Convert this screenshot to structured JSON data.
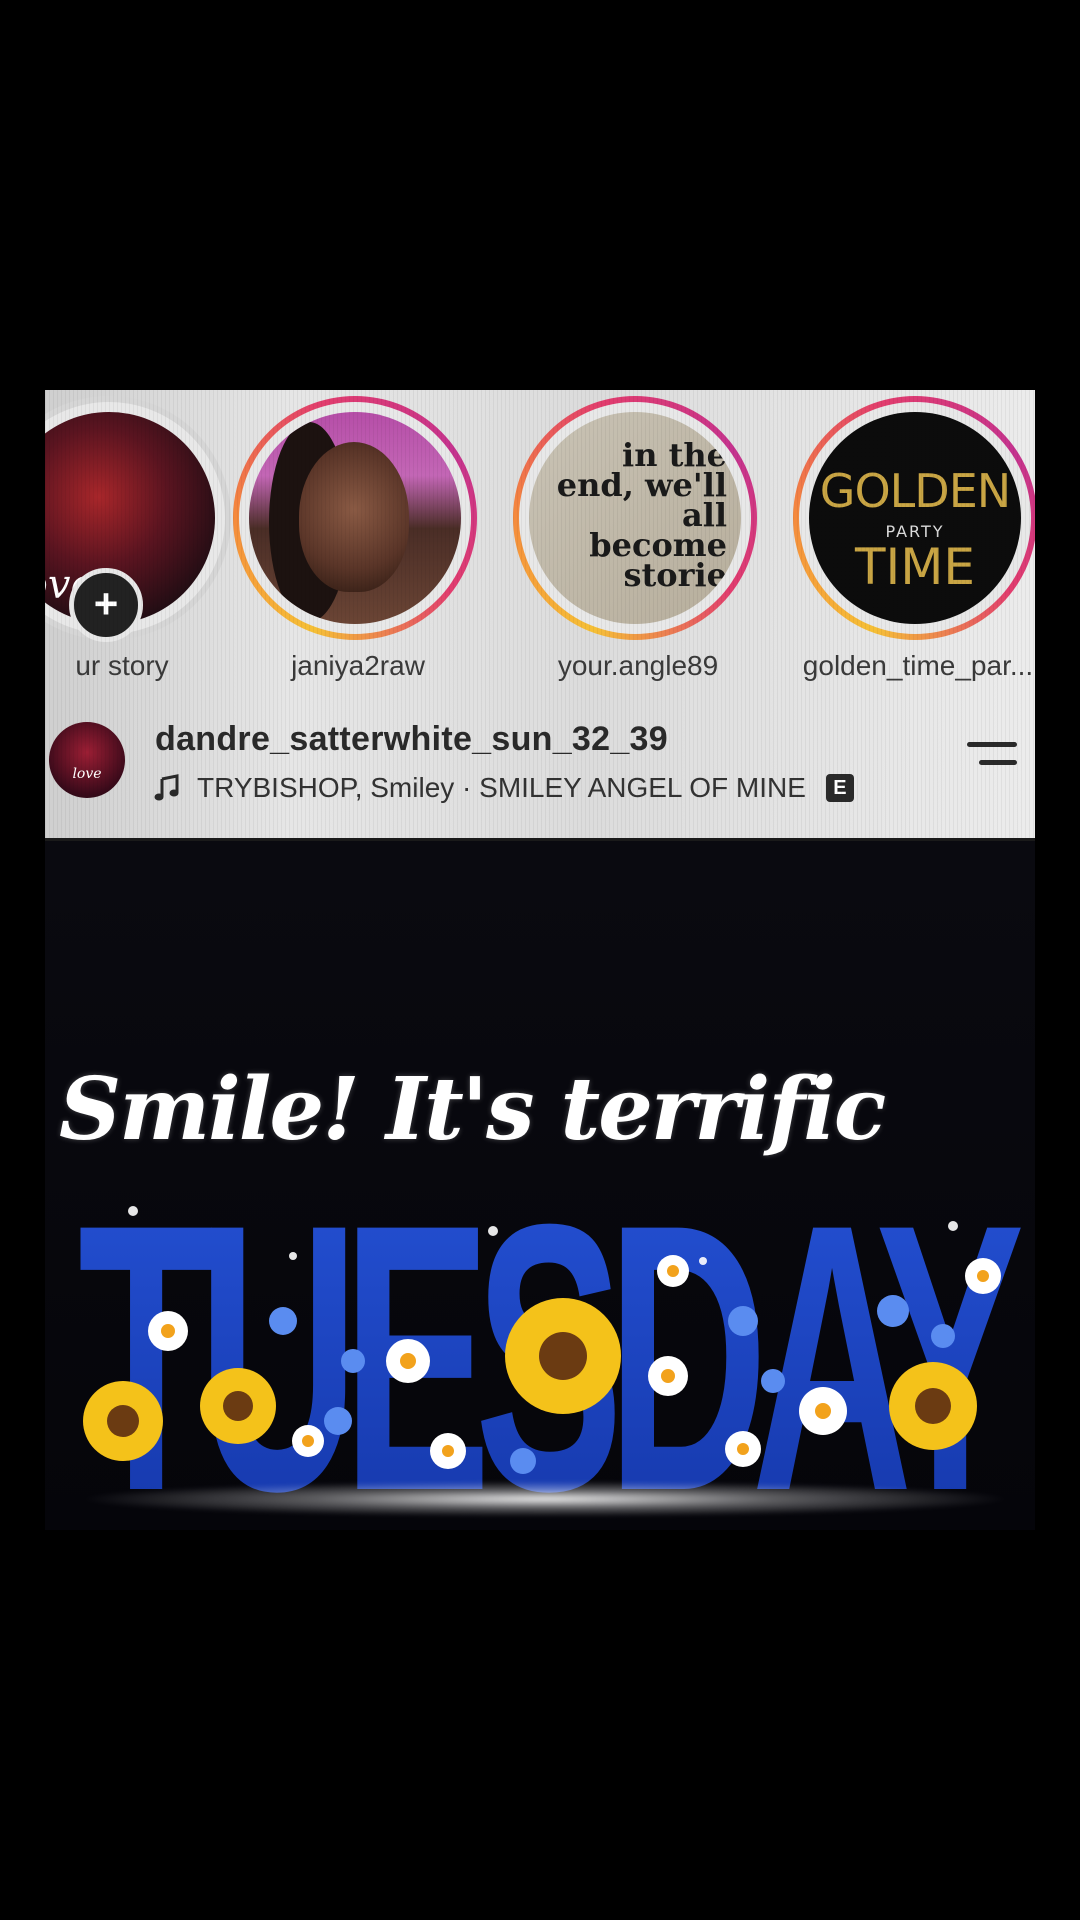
{
  "stories": [
    {
      "label": "ur story",
      "ring": "none",
      "has_add_button": true,
      "overlay_text": "love"
    },
    {
      "label": "janiya2raw",
      "ring": "gradient"
    },
    {
      "label": "your.angle89",
      "ring": "gradient",
      "picture_text": "in the end, we'll all become storie"
    },
    {
      "label": "golden_time_par...",
      "ring": "gradient",
      "picture_text": {
        "line1": "GOLDEN",
        "line2": "PARTY",
        "line3": "TIME"
      }
    }
  ],
  "post": {
    "username": "dandre_satterwhite_sun_32_39",
    "audio": "TRYBISHOP, Smiley · SMILEY ANGEL OF MINE",
    "explicit_badge": "E",
    "avatar_text": "love",
    "music_icon": "music-note-icon",
    "menu_icon": "menu-icon"
  },
  "image": {
    "headline": "Smile! It's terrific",
    "big_word": "TUESDAY"
  },
  "colors": {
    "story_ring_start": "#f6c036",
    "story_ring_end": "#c5338f",
    "big_word_blue": "#1e45c8",
    "sunflower": "#f4c21a"
  }
}
